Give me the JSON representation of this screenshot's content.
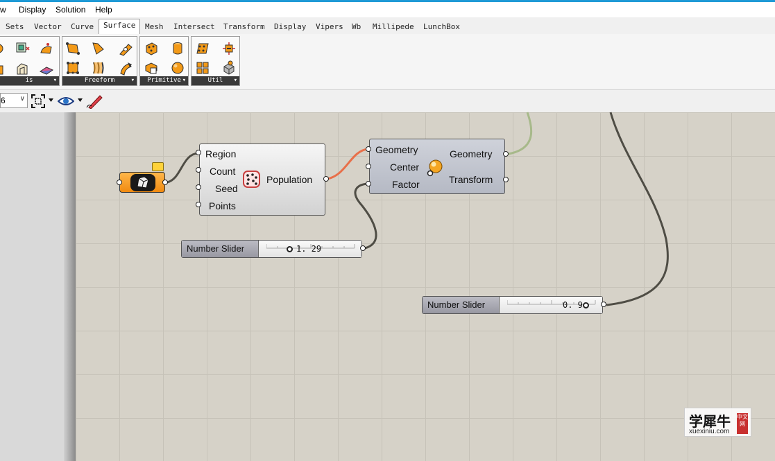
{
  "menu": {
    "items": [
      "w",
      "Display",
      "Solution",
      "Help"
    ]
  },
  "tabs": [
    "Sets",
    "Vector",
    "Curve",
    "Surface",
    "Mesh",
    "Intersect",
    "Transform",
    "Display",
    "Vipers",
    "Wb",
    "Millipede",
    "LunchBox"
  ],
  "active_tab": "Surface",
  "ribbon": {
    "groups": [
      {
        "label": "is"
      },
      {
        "label": "Freeform"
      },
      {
        "label": "Primitive"
      },
      {
        "label": "Util"
      }
    ],
    "expand_glyph": "▾"
  },
  "toolbar": {
    "zoom_value": "6",
    "zoom_chevron": "∨"
  },
  "components": {
    "populate": {
      "inputs": [
        "Region",
        "Count",
        "Seed",
        "Points"
      ],
      "output": "Population"
    },
    "scale": {
      "inputs": [
        "Geometry",
        "Center",
        "Factor"
      ],
      "outputs": [
        "Geometry",
        "Transform"
      ]
    }
  },
  "sliders": [
    {
      "name": "Number Slider",
      "value": "1. 29"
    },
    {
      "name": "Number Slider",
      "value": "0. 9"
    }
  ],
  "watermark": {
    "text": "学犀牛",
    "url": "xuexiniu.com",
    "stamp": "中文网"
  },
  "colors": {
    "accent_blue": "#1f9ad6",
    "wire_selected": "#e8704a",
    "wire_default": "#4f4d45",
    "wire_green": "#a7b98a",
    "icon_orange": "#f39a18"
  }
}
